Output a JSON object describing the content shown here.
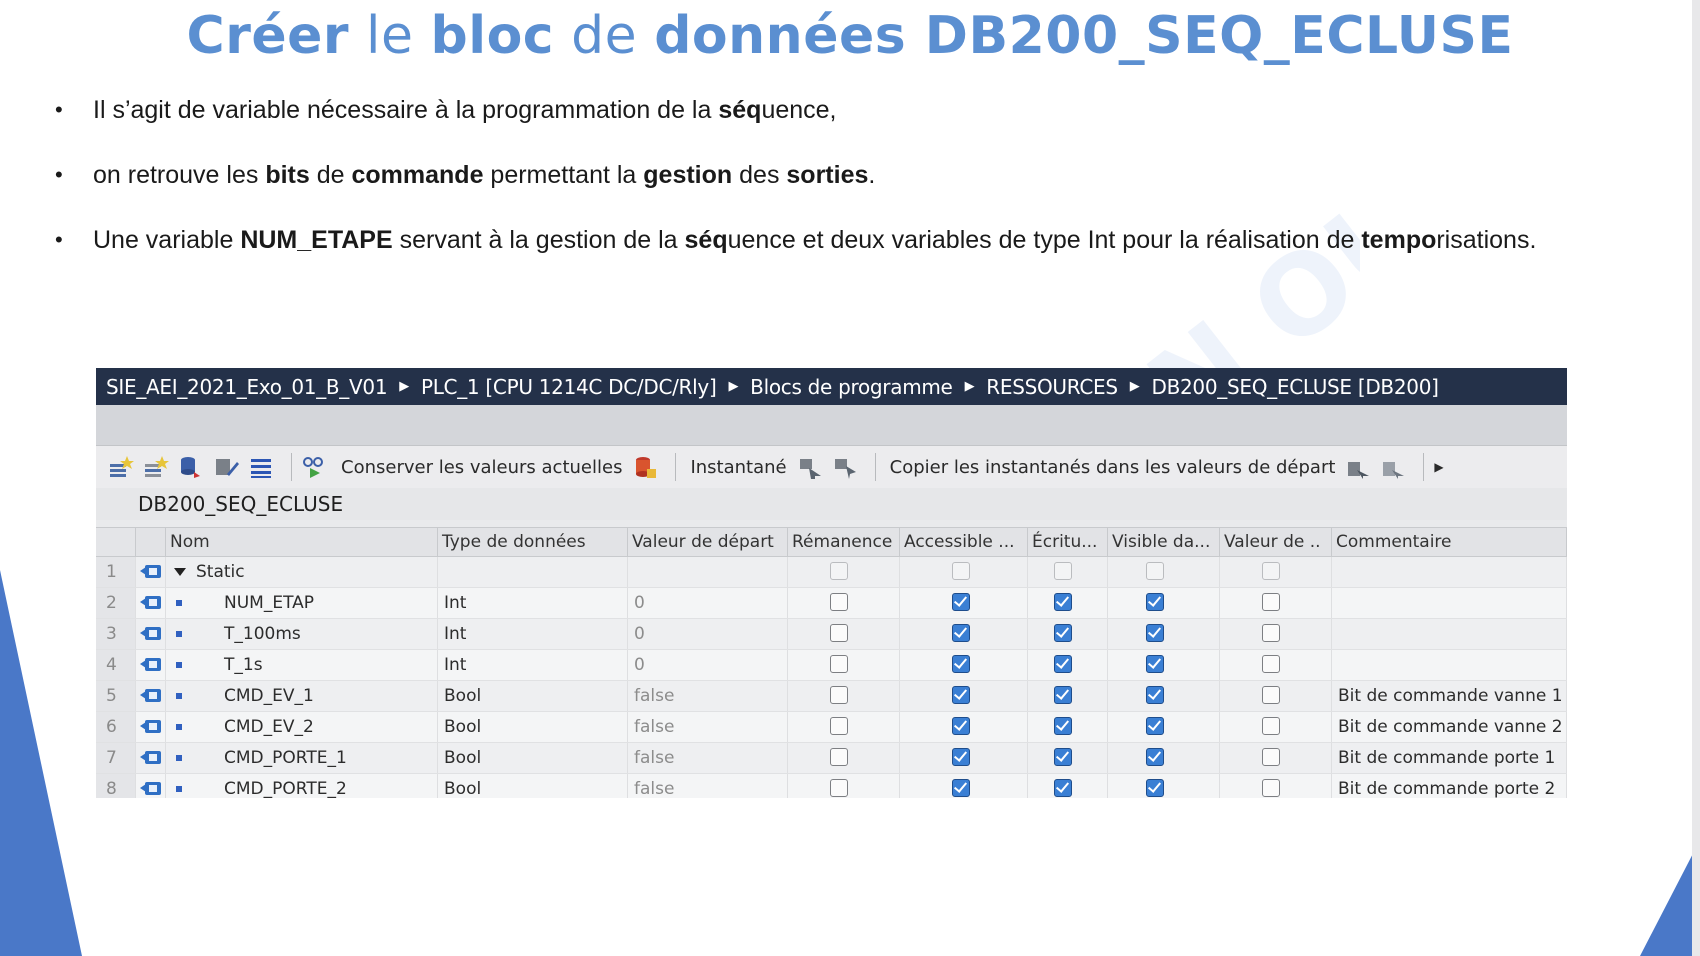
{
  "slide": {
    "title_parts": [
      {
        "text": "Créer",
        "bold": true
      },
      {
        "text": " le ",
        "bold": false
      },
      {
        "text": "bloc",
        "bold": true
      },
      {
        "text": " de ",
        "bold": false
      },
      {
        "text": "données DB200_SEQ_ECLUSE",
        "bold": true
      }
    ],
    "bullets": [
      [
        {
          "text": "Il s’agit de variable nécessaire à la programmation de la ",
          "bold": false
        },
        {
          "text": "séq",
          "bold": true
        },
        {
          "text": "uence,",
          "bold": false
        }
      ],
      [
        {
          "text": "on retrouve les ",
          "bold": false
        },
        {
          "text": "bits",
          "bold": true
        },
        {
          "text": " de ",
          "bold": false
        },
        {
          "text": "commande",
          "bold": true
        },
        {
          "text": " permettant la ",
          "bold": false
        },
        {
          "text": "gestion",
          "bold": true
        },
        {
          "text": " des ",
          "bold": false
        },
        {
          "text": "sorties",
          "bold": true
        },
        {
          "text": ".",
          "bold": false
        }
      ],
      [
        {
          "text": "Une variable ",
          "bold": false
        },
        {
          "text": "NUM_ETAPE",
          "bold": true
        },
        {
          "text": " servant à la gestion de la ",
          "bold": false
        },
        {
          "text": "séq",
          "bold": true
        },
        {
          "text": "uence et deux variables de type Int pour la réalisation de ",
          "bold": false
        },
        {
          "text": "tempo",
          "bold": true
        },
        {
          "text": "risations.",
          "bold": false
        }
      ]
    ],
    "bullet_symbol": "•",
    "watermark": "ON OUEST"
  },
  "tia": {
    "breadcrumb": [
      "SIE_AEI_2021_Exo_01_B_V01",
      "PLC_1 [CPU 1214C DC/DC/Rly]",
      "Blocs de programme",
      "RESSOURCES",
      "DB200_SEQ_ECLUSE [DB200]"
    ],
    "breadcrumb_sep": "▶",
    "toolbar": {
      "keep_values_label": "Conserver les valeurs actuelles",
      "snapshot_label": "Instantané",
      "copy_snapshots_label": "Copier les instantanés dans les valeurs de départ",
      "more_arrow": "▶"
    },
    "db_name": "DB200_SEQ_ECLUSE",
    "columns": [
      "Nom",
      "Type de données",
      "Valeur de départ",
      "Rémanence",
      "Accessible ...",
      "Écritu...",
      "Visible da...",
      "Valeur de ..",
      "Commentaire"
    ],
    "rows": [
      {
        "num": "1",
        "name": "Static",
        "type": "",
        "start": "",
        "rem": false,
        "acc": false,
        "ecr": false,
        "vis": false,
        "vde": false,
        "comment": "",
        "is_group": true
      },
      {
        "num": "2",
        "name": "NUM_ETAP",
        "type": "Int",
        "start": "0",
        "rem": false,
        "acc": true,
        "ecr": true,
        "vis": true,
        "vde": false,
        "comment": "",
        "is_group": false
      },
      {
        "num": "3",
        "name": "T_100ms",
        "type": "Int",
        "start": "0",
        "rem": false,
        "acc": true,
        "ecr": true,
        "vis": true,
        "vde": false,
        "comment": "",
        "is_group": false
      },
      {
        "num": "4",
        "name": "T_1s",
        "type": "Int",
        "start": "0",
        "rem": false,
        "acc": true,
        "ecr": true,
        "vis": true,
        "vde": false,
        "comment": "",
        "is_group": false
      },
      {
        "num": "5",
        "name": "CMD_EV_1",
        "type": "Bool",
        "start": "false",
        "rem": false,
        "acc": true,
        "ecr": true,
        "vis": true,
        "vde": false,
        "comment": "Bit de commande vanne 1",
        "is_group": false
      },
      {
        "num": "6",
        "name": "CMD_EV_2",
        "type": "Bool",
        "start": "false",
        "rem": false,
        "acc": true,
        "ecr": true,
        "vis": true,
        "vde": false,
        "comment": "Bit de commande vanne 2",
        "is_group": false
      },
      {
        "num": "7",
        "name": "CMD_PORTE_1",
        "type": "Bool",
        "start": "false",
        "rem": false,
        "acc": true,
        "ecr": true,
        "vis": true,
        "vde": false,
        "comment": "Bit de commande porte 1",
        "is_group": false
      },
      {
        "num": "8",
        "name": "CMD_PORTE_2",
        "type": "Bool",
        "start": "false",
        "rem": false,
        "acc": true,
        "ecr": true,
        "vis": true,
        "vde": false,
        "comment": "Bit de commande porte 2",
        "is_group": false
      }
    ],
    "colors": {
      "title_blue": "#5b8fd1",
      "breadcrumb_bg": "#243149",
      "check_blue": "#3a7fd4",
      "deco_blue": "#4a78c8"
    }
  }
}
